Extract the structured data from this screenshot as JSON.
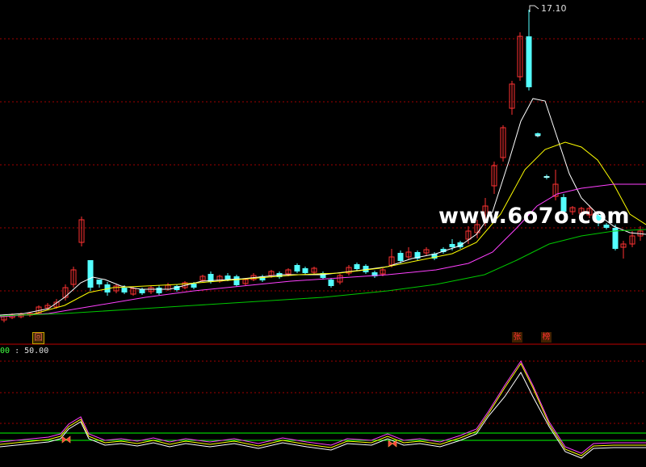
{
  "price_panel": {
    "high_marker": "17.10",
    "watermark": "www.6o7o.com"
  },
  "badges": {
    "back": "回",
    "zhang": "张",
    "bang": "榜"
  },
  "indicator": {
    "label_prefix": "00",
    "label_value": ": 50.00"
  },
  "colors": {
    "up": "#ff3232",
    "down": "#54ffff",
    "ma_white": "#ffffff",
    "ma_yellow": "#ffff00",
    "ma_magenta": "#ff40ff",
    "ma_green": "#00c800",
    "grid": "#a00000",
    "osc_green": "#00ff00"
  },
  "chart_data": {
    "type": "candlestick",
    "high_label": 17.1,
    "indicator_reference": 50.0
  }
}
